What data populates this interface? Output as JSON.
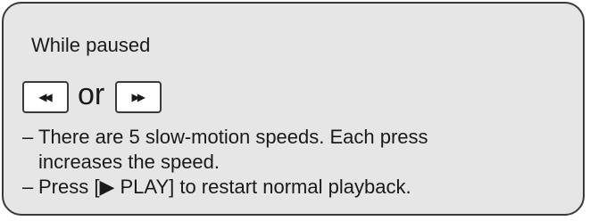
{
  "heading": "While paused",
  "buttons": {
    "rewind_icon": "rewind-icon",
    "forward_icon": "fast-forward-icon",
    "rewind_glyph": "◀◀",
    "forward_glyph": "▶▶",
    "connector": "or"
  },
  "notes": [
    {
      "dash": "–",
      "line1": "There are 5 slow-motion speeds. Each press",
      "line2": "increases the speed."
    },
    {
      "dash": "–",
      "line1": "Press [▶ PLAY] to restart normal playback."
    }
  ],
  "colors": {
    "panel_background": "#e6e6e6",
    "border": "#3a3a3a",
    "key_background": "#ffffff"
  }
}
